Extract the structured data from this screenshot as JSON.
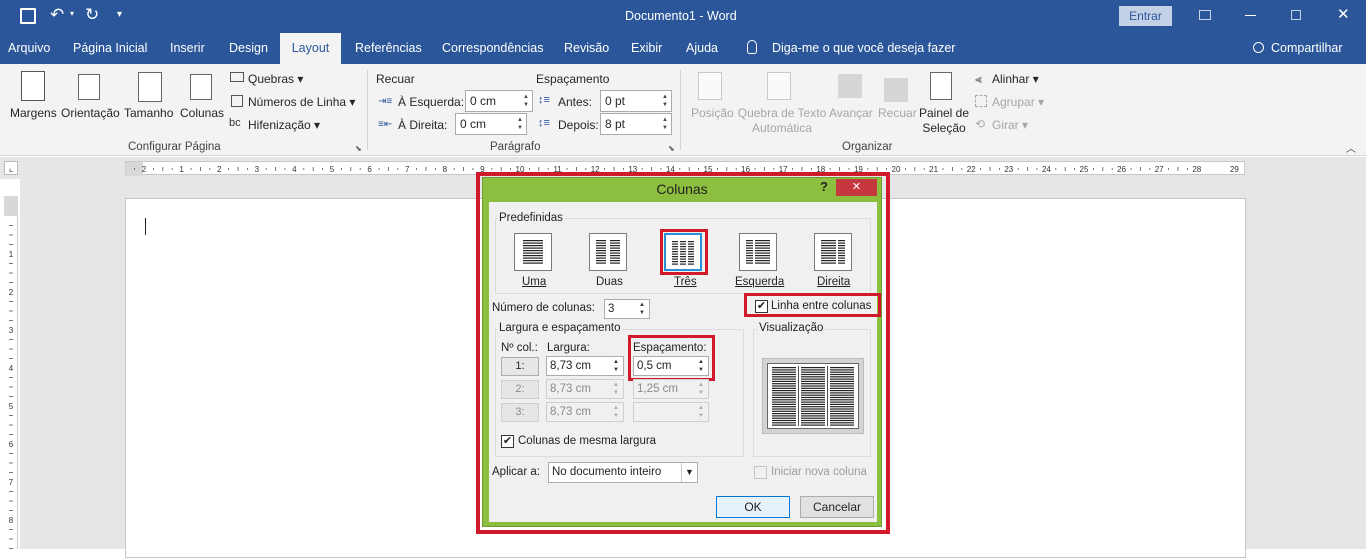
{
  "titlebar": {
    "doc_title": "Documento1",
    "separator": "-",
    "app": "Word",
    "signin": "Entrar"
  },
  "tabs": [
    "Arquivo",
    "Página Inicial",
    "Inserir",
    "Design",
    "Layout",
    "Referências",
    "Correspondências",
    "Revisão",
    "Exibir",
    "Ajuda"
  ],
  "tellme": "Diga-me o que você deseja fazer",
  "share": "Compartilhar",
  "ribbon": {
    "page_setup": {
      "margins": "Margens",
      "orientation": "Orientação",
      "size": "Tamanho",
      "columns": "Colunas",
      "breaks": "Quebras",
      "line_numbers": "Números de Linha",
      "hyphenation": "Hifenização",
      "group": "Configurar Página"
    },
    "paragraph": {
      "indent": "Recuar",
      "spacing": "Espaçamento",
      "left_label": "À Esquerda:",
      "left_value": "0 cm",
      "right_label": "À Direita:",
      "right_value": "0 cm",
      "before_label": "Antes:",
      "before_value": "0 pt",
      "after_label": "Depois:",
      "after_value": "8 pt",
      "group": "Parágrafo"
    },
    "arrange": {
      "position": "Posição",
      "wrap_text": "Quebra de Texto Automática",
      "forward": "Avançar",
      "backward": "Recuar",
      "selection_pane": "Painel de Seleção",
      "align": "Alinhar",
      "group_btn": "Agrupar",
      "rotate": "Girar",
      "group": "Organizar"
    }
  },
  "ruler": {
    "numbers": [
      "1",
      "2",
      "1",
      "2",
      "3",
      "4",
      "5",
      "6",
      "7",
      "8",
      "9",
      "10",
      "11",
      "12",
      "13",
      "14",
      "15",
      "16",
      "17",
      "18",
      "19",
      "20",
      "21",
      "22",
      "23",
      "24",
      "25",
      "26",
      "27",
      "28",
      "29"
    ],
    "vnumbers": [
      "1",
      "2",
      "3",
      "4",
      "5",
      "6",
      "7",
      "8"
    ]
  },
  "dialog": {
    "title": "Colunas",
    "help": "?",
    "close": "✕",
    "presets_label": "Predefinidas",
    "presets": [
      "Uma",
      "Duas",
      "Três",
      "Esquerda",
      "Direita"
    ],
    "num_columns_label": "Número de colunas:",
    "num_columns_value": "3",
    "line_between": "Linha entre colunas",
    "width_spacing_label": "Largura e espaçamento",
    "col_no_header": "Nº col.:",
    "width_header": "Largura:",
    "spacing_header": "Espaçamento:",
    "rows": [
      {
        "col": "1:",
        "width": "8,73 cm",
        "spacing": "0,5 cm"
      },
      {
        "col": "2:",
        "width": "8,73 cm",
        "spacing": "1,25 cm"
      },
      {
        "col": "3:",
        "width": "8,73 cm",
        "spacing": ""
      }
    ],
    "equal_width": "Colunas de mesma largura",
    "preview_label": "Visualização",
    "apply_label": "Aplicar a:",
    "apply_value": "No documento inteiro",
    "new_column": "Iniciar nova coluna",
    "ok": "OK",
    "cancel": "Cancelar"
  }
}
